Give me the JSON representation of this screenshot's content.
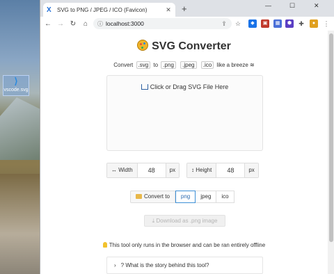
{
  "desktop": {
    "icon_label": "vscode.svg"
  },
  "browser": {
    "tab_title": "SVG to PNG / JPEG / ICO (Favicon)",
    "tab_close": "✕",
    "new_tab": "+",
    "minimize": "—",
    "maximize": "☐",
    "window_close": "✕",
    "url": "localhost:3000",
    "nav": {
      "back": "←",
      "forward": "→",
      "reload": "↻",
      "home": "⌂"
    }
  },
  "page": {
    "title": "SVG Converter",
    "tagline": {
      "convert": "Convert",
      "from_ext": ".svg",
      "to": "to",
      "png": ".png",
      "jpeg": ".jpeg",
      "ico": ".ico",
      "suffix": "like a breeze"
    },
    "dropzone_text": "Click or Drag SVG File Here",
    "width": {
      "label": "↔ Width",
      "value": "48",
      "unit": "px"
    },
    "height": {
      "label": "↕ Height",
      "value": "48",
      "unit": "px"
    },
    "format": {
      "label": "Convert to",
      "options": [
        "png",
        "jpeg",
        "ico"
      ],
      "selected": "png"
    },
    "download_label": "Download as .png image",
    "info_text": "This tool only runs in the browser and can be ran entirely offline",
    "details_summary": "What is the story behind this tool?"
  },
  "colors": {
    "accent": "#3d8fd6",
    "tab_strip": "#dee1e6"
  }
}
